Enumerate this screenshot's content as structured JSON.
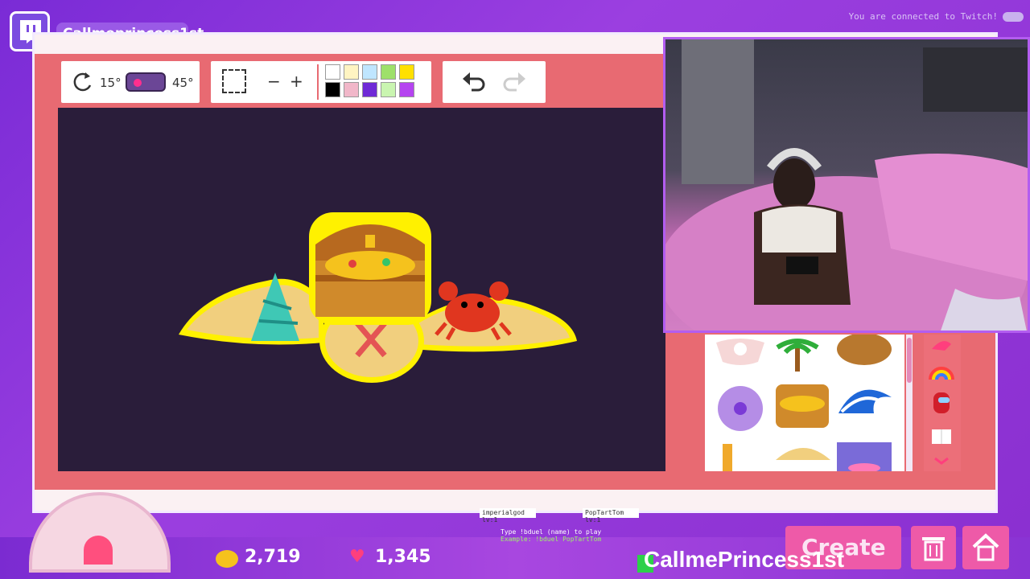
{
  "channel": {
    "name": "Callmeprincess1st"
  },
  "status": {
    "text": "You are connected to Twitch!"
  },
  "toolbar": {
    "rotate_left_label": "15°",
    "rotate_right_label": "45°",
    "zoom_out": "−",
    "zoom_in": "+",
    "palette": [
      "#ffffff",
      "#fff4c2",
      "#bfe6ff",
      "#9ee06a",
      "#ffe000",
      "#000000",
      "#f1b7c9",
      "#6f2ad6",
      "#c9f5b0",
      "#b544f0"
    ]
  },
  "minigame": {
    "player1": "imperialgod lv:1",
    "player2": "PopTartTom lv:1",
    "instruction": "Type !bduel (name) to play",
    "example": "Example: !bduel PopTartTom"
  },
  "hud": {
    "coins": "2,719",
    "hearts": "1,345",
    "create_label": "Create",
    "handle": "CallmePrincess1st",
    "accent": "#ee5aa8"
  },
  "tray_items": [
    "shell-sticker",
    "palm-tree-sticker",
    "coconut-sticker",
    "hibiscus-sticker",
    "treasure-chest-sticker",
    "wave-sticker",
    "candle-sticker",
    "sand-sticker",
    "sunset-sticker"
  ],
  "side_items": [
    "hat-sticker",
    "rainbow-sticker",
    "crewmate-sticker",
    "book-sticker"
  ]
}
